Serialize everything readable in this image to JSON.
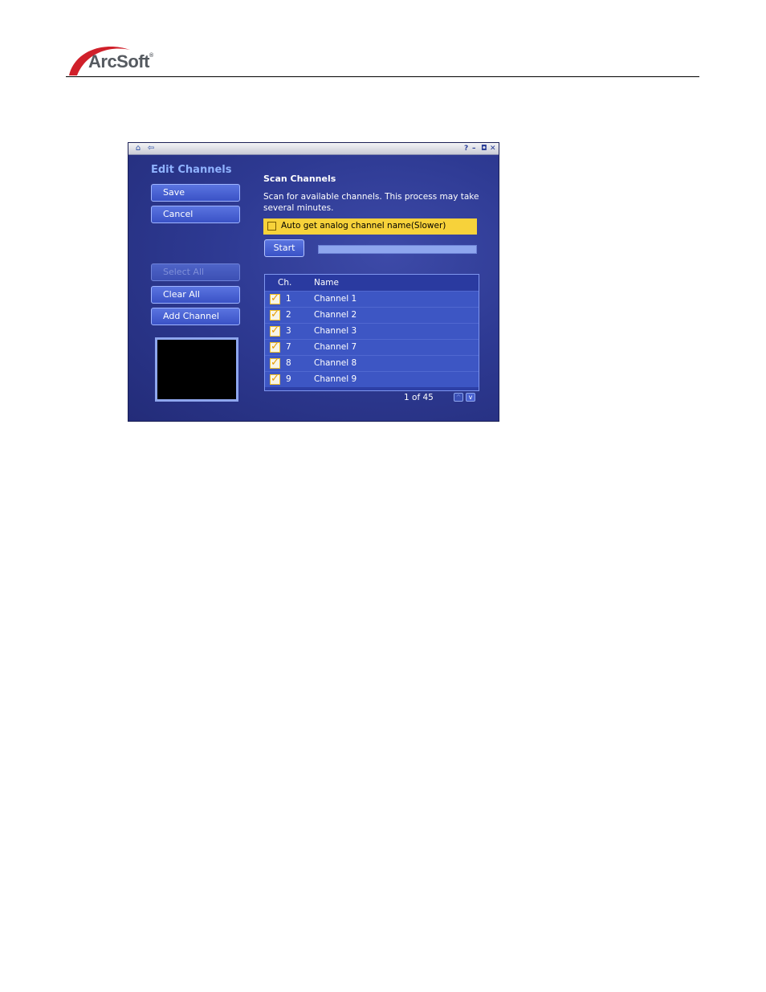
{
  "logo": {
    "brand": "ArcSoft",
    "mark": "®"
  },
  "app": {
    "titlebar": {
      "home_icon": "home-icon",
      "back_icon": "back-arrow-icon",
      "controls": [
        "?",
        "–",
        "◘",
        "✕"
      ]
    },
    "left": {
      "heading": "Edit Channels",
      "buttons": {
        "save": "Save",
        "cancel": "Cancel",
        "select_all": "Select All",
        "clear_all": "Clear All",
        "add_channel": "Add Channel"
      }
    },
    "scan": {
      "title": "Scan Channels",
      "description": "Scan for available channels. This process may take several minutes.",
      "auto_label": "Auto get analog channel name(Slower)",
      "auto_checked": false,
      "start_label": "Start",
      "progress": 0
    },
    "list": {
      "col_ch": "Ch.",
      "col_name": "Name",
      "rows": [
        {
          "ch": "1",
          "name": "Channel 1",
          "checked": true
        },
        {
          "ch": "2",
          "name": "Channel 2",
          "checked": true
        },
        {
          "ch": "3",
          "name": "Channel 3",
          "checked": true
        },
        {
          "ch": "7",
          "name": "Channel 7",
          "checked": true
        },
        {
          "ch": "8",
          "name": "Channel 8",
          "checked": true
        },
        {
          "ch": "9",
          "name": "Channel 9",
          "checked": true
        }
      ]
    },
    "pager": {
      "text": "1 of 45",
      "up": "^",
      "down": "v"
    }
  }
}
